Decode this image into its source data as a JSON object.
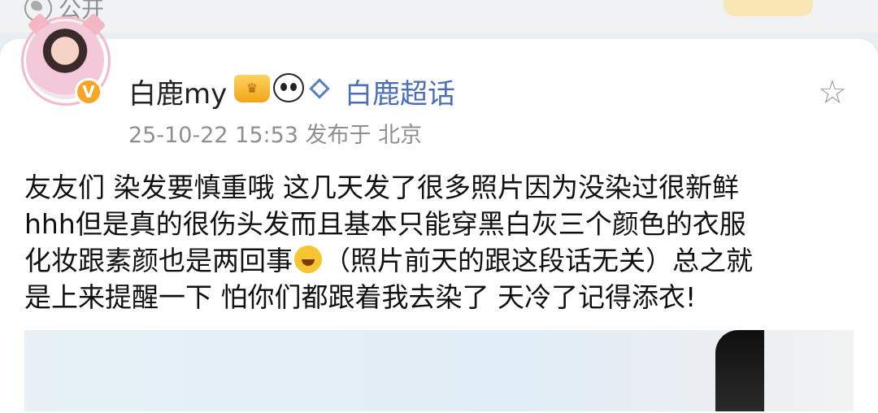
{
  "visibility": {
    "icon": "globe-icon",
    "label": "公开"
  },
  "post": {
    "author": "白鹿my",
    "badges": [
      "crown-badge-icon",
      "panda-icon",
      "diamond-icon"
    ],
    "topic": "白鹿超话",
    "time_location": "25-10-22 15:53  发布于 北京",
    "verified_badge": "V",
    "favorite_icon": "star-icon",
    "text_part1": "友友们 染发要慎重哦 这几天发了很多照片因为没染过很新鲜\nhhh但是真的很伤头发而且基本只能穿黑白灰三个颜色的衣服\n化妆跟素颜也是两回事",
    "text_part2": "（照片前天的跟这段话无关）总之就\n是上来提醒一下 怕你们都跟着我去染了 天冷了记得添衣!"
  },
  "colors": {
    "accent": "#4a6fb8",
    "meta": "#8f8f8f",
    "badge": "#f5a623"
  }
}
